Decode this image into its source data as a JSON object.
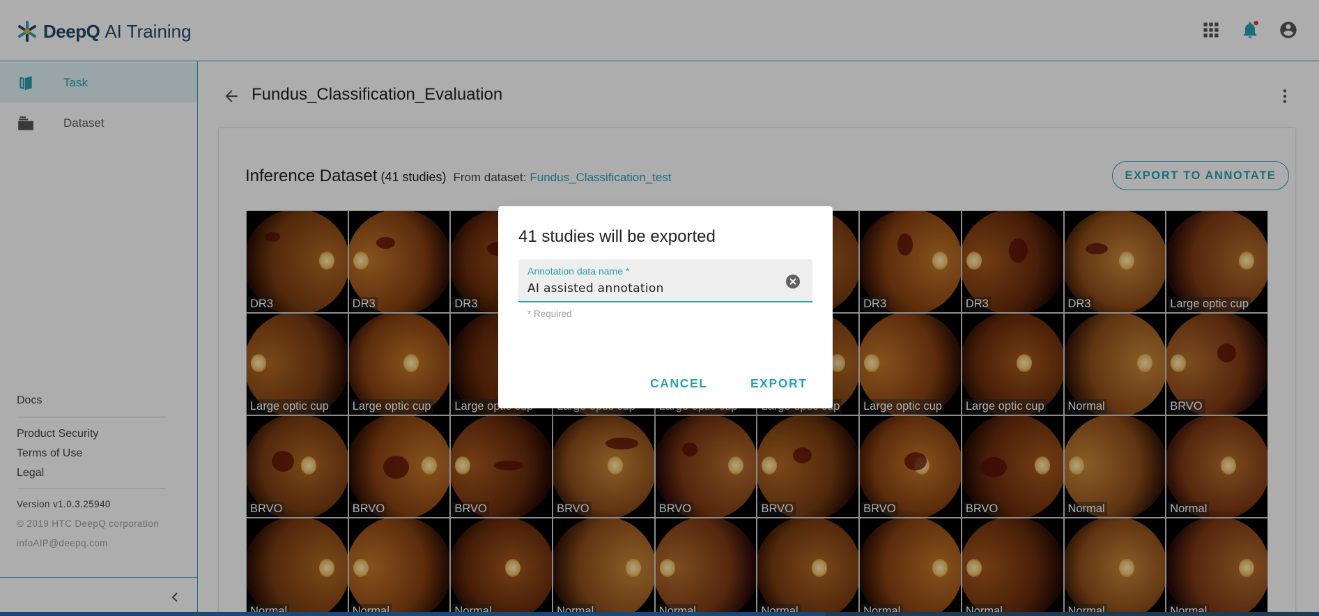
{
  "app": {
    "brand": "DeepQ",
    "product": "AI Training"
  },
  "topbar": {
    "icons": [
      "apps-icon",
      "notifications-icon",
      "account-icon"
    ]
  },
  "sidebar": {
    "items": [
      {
        "label": "Task",
        "icon": "book-icon",
        "active": true
      },
      {
        "label": "Dataset",
        "icon": "folder-icon",
        "active": false
      }
    ],
    "footer_links": [
      "Docs",
      "Product Security",
      "Terms of Use",
      "Legal"
    ],
    "version": "Version v1.0.3.25940",
    "copyright": "© 2019 HTC DeepQ corporation",
    "email": "infoAIP@deepq.com"
  },
  "page": {
    "title": "Fundus_Classification_Evaluation"
  },
  "dataset_section": {
    "title": "Inference Dataset",
    "count": "(41 studies)",
    "from_label": "From dataset:",
    "from_link": "Fundus_Classification_test",
    "export_button": "EXPORT TO ANNOTATE"
  },
  "grid": {
    "labels": [
      "DR3",
      "DR3",
      "DR3",
      "",
      "",
      "",
      "DR3",
      "DR3",
      "DR3",
      "Large optic cup",
      "Large optic cup",
      "Large optic cup",
      "Large optic cup",
      "Large optic cup",
      "Large optic cup",
      "Large optic cup",
      "Large optic cup",
      "Large optic cup",
      "Normal",
      "BRVO",
      "BRVO",
      "BRVO",
      "BRVO",
      "BRVO",
      "BRVO",
      "BRVO",
      "BRVO",
      "BRVO",
      "Normal",
      "Normal",
      "Normal",
      "Normal",
      "Normal",
      "Normal",
      "Normal",
      "Normal",
      "Normal",
      "Normal",
      "Normal",
      "Normal"
    ]
  },
  "dialog": {
    "title": "41 studies will be exported",
    "field_label": "Annotation data name *",
    "field_value": "AI assisted annotation",
    "helper": "* Required",
    "cancel": "CANCEL",
    "export": "EXPORT"
  },
  "colors": {
    "accent": "#2a9fb4",
    "brand": "#1f4a6b"
  }
}
